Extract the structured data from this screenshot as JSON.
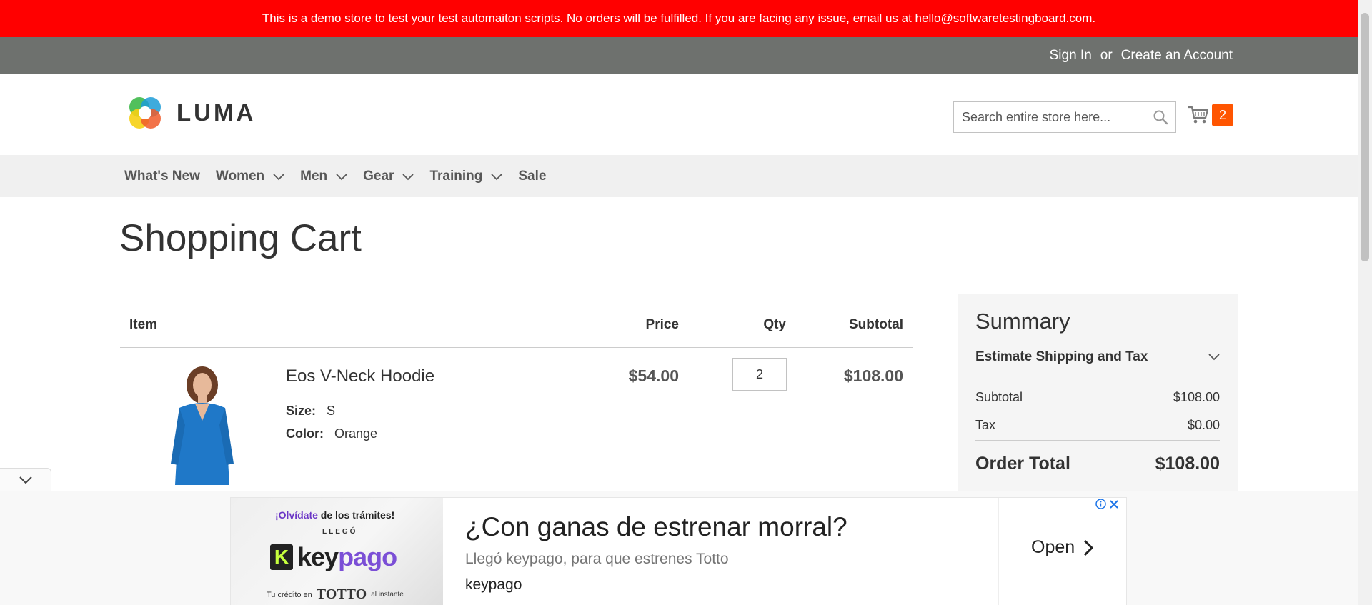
{
  "promo": {
    "message": "This is a demo store to test your test automaiton scripts. No orders will be fulfilled. If you are facing any issue, email us at hello@softwaretestingboard.com."
  },
  "header_links": {
    "sign_in": "Sign In",
    "or": "or",
    "create_account": "Create an Account"
  },
  "logo": {
    "text": "LUMA"
  },
  "search": {
    "placeholder": "Search entire store here..."
  },
  "minicart": {
    "count": "2"
  },
  "nav": {
    "items": [
      {
        "label": "What's New",
        "has_dropdown": false
      },
      {
        "label": "Women",
        "has_dropdown": true
      },
      {
        "label": "Men",
        "has_dropdown": true
      },
      {
        "label": "Gear",
        "has_dropdown": true
      },
      {
        "label": "Training",
        "has_dropdown": true
      },
      {
        "label": "Sale",
        "has_dropdown": false
      }
    ]
  },
  "page": {
    "title": "Shopping Cart"
  },
  "cart_table": {
    "headers": {
      "item": "Item",
      "price": "Price",
      "qty": "Qty",
      "subtotal": "Subtotal"
    },
    "items": [
      {
        "name": "Eos V-Neck Hoodie",
        "size_label": "Size:",
        "size_value": "S",
        "color_label": "Color:",
        "color_value": "Orange",
        "price": "$54.00",
        "qty": "2",
        "subtotal": "$108.00"
      }
    ]
  },
  "summary": {
    "title": "Summary",
    "estimate_label": "Estimate Shipping and Tax",
    "subtotal_label": "Subtotal",
    "subtotal_value": "$108.00",
    "tax_label": "Tax",
    "tax_value": "$0.00",
    "total_label": "Order Total",
    "total_value": "$108.00"
  },
  "ad": {
    "image_line1_purple": "¡Olvídate",
    "image_line1_rest": " de los trámites!",
    "image_line2": "LLEGÓ",
    "image_brand_a": "key",
    "image_brand_b": "pago",
    "image_line3": "Tu crédito en",
    "image_line3_brand": "TOTTO",
    "image_line3_end": "al instante",
    "title": "¿Con ganas de estrenar morral?",
    "description": "Llegó keypago, para que estrenes Totto",
    "advertiser": "keypago",
    "cta": "Open"
  },
  "colors": {
    "promo_bg": "#ff0000",
    "topbar_bg": "#6e716e",
    "nav_bg": "#f0f0f0",
    "cart_badge": "#ff5501",
    "summary_bg": "#f5f5f5",
    "adchoices_blue": "#1a73e8"
  }
}
